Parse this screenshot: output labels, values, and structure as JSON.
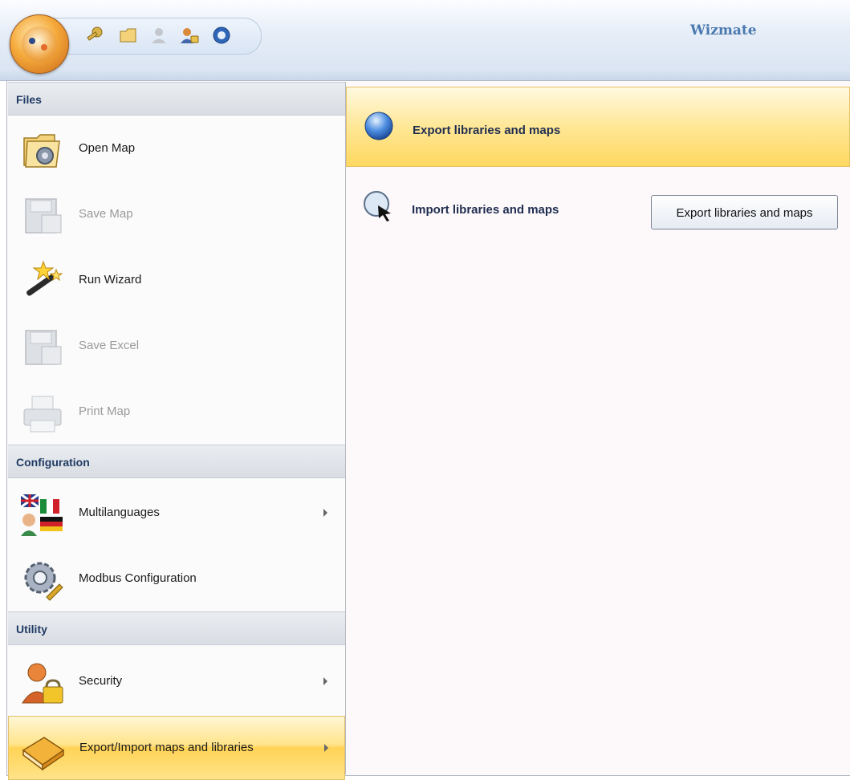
{
  "app": {
    "title": "Wizmate"
  },
  "quick_access": [
    {
      "icon": "key-icon"
    },
    {
      "icon": "folder-icon"
    },
    {
      "icon": "user-disabled-icon"
    },
    {
      "icon": "users-icon"
    },
    {
      "icon": "globe-icon"
    }
  ],
  "sections": {
    "files": "Files",
    "configuration": "Configuration",
    "utility": "Utility"
  },
  "items": {
    "open_map": "Open Map",
    "save_map": "Save Map",
    "run_wizard": "Run Wizard",
    "save_excel": "Save Excel",
    "print_map": "Print Map",
    "multilanguages": "Multilanguages",
    "modbus": "Modbus Configuration",
    "security": "Security",
    "export_import": "Export/Import maps and libraries"
  },
  "submenu": {
    "export": "Export libraries and maps",
    "import": "Import libraries and maps"
  },
  "tooltip": "Export libraries and maps",
  "colors": {
    "highlight": "#ffd960",
    "section_header": "#dde1e7",
    "title_text": "#4a79b0",
    "submenu_text": "#1f2d50"
  }
}
